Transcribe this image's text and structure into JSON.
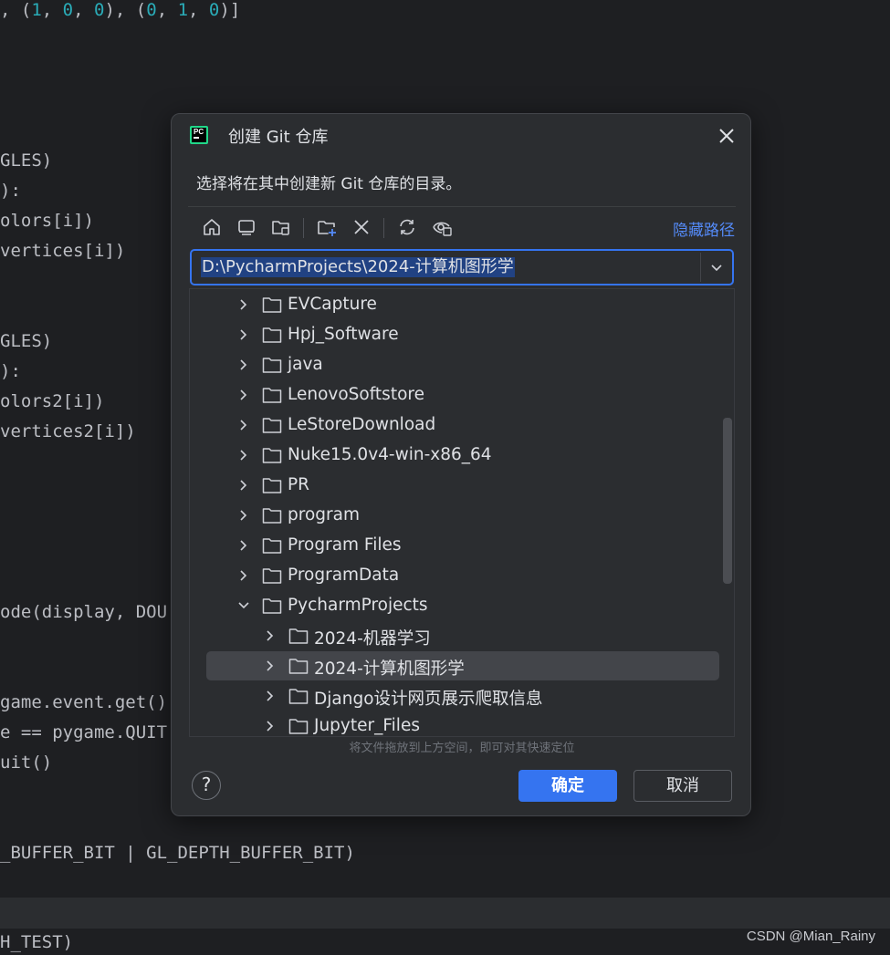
{
  "editor": {
    "lines": [
      {
        "segments": [
          {
            "t": ", (",
            "c": ""
          },
          {
            "t": "1",
            "c": "num"
          },
          {
            "t": ", ",
            "c": ""
          },
          {
            "t": "0",
            "c": "num"
          },
          {
            "t": ", ",
            "c": ""
          },
          {
            "t": "0",
            "c": "num"
          },
          {
            "t": "), (",
            "c": ""
          },
          {
            "t": "0",
            "c": "num"
          },
          {
            "t": ", ",
            "c": ""
          },
          {
            "t": "1",
            "c": "num"
          },
          {
            "t": ", ",
            "c": ""
          },
          {
            "t": "0",
            "c": "num"
          },
          {
            "t": ")]",
            "c": ""
          }
        ]
      },
      {
        "segments": [
          {
            "t": "GLES)",
            "c": ""
          }
        ]
      },
      {
        "segments": [
          {
            "t": "):",
            "c": ""
          }
        ]
      },
      {
        "segments": [
          {
            "t": "olors[i])",
            "c": ""
          }
        ]
      },
      {
        "segments": [
          {
            "t": "vertices[i])",
            "c": ""
          }
        ]
      },
      {
        "segments": [
          {
            "t": "GLES)",
            "c": ""
          }
        ]
      },
      {
        "segments": [
          {
            "t": "):",
            "c": ""
          }
        ]
      },
      {
        "segments": [
          {
            "t": "olors2[i])",
            "c": ""
          }
        ]
      },
      {
        "segments": [
          {
            "t": "vertices2[i])",
            "c": ""
          }
        ]
      },
      {
        "segments": [
          {
            "t": "ode(display, DOU",
            "c": ""
          }
        ]
      },
      {
        "segments": [
          {
            "t": "game.event.get():",
            "c": ""
          }
        ]
      },
      {
        "segments": [
          {
            "t": "e == pygame.QUIT",
            "c": ""
          }
        ]
      },
      {
        "segments": [
          {
            "t": "uit()",
            "c": ""
          }
        ]
      },
      {
        "segments": [
          {
            "t": "_BUFFER_BIT | GL_DEPTH_BUFFER_BIT)",
            "c": ""
          }
        ]
      },
      {
        "segments": [
          {
            "t": "H_TEST)",
            "c": ""
          }
        ]
      }
    ],
    "watermark": "CSDN @Mian_Rainy"
  },
  "dialog": {
    "title": "创建 Git 仓库",
    "subtitle": "选择将在其中创建新 Git 仓库的目录。",
    "hide_path_label": "隐藏路径",
    "path_value": "D:\\PycharmProjects\\2024-计算机图形学",
    "toolbar": [
      {
        "name": "home-icon"
      },
      {
        "name": "desktop-icon"
      },
      {
        "name": "project-folder-icon"
      },
      {
        "name": "new-folder-icon"
      },
      {
        "name": "delete-icon"
      },
      {
        "name": "refresh-icon"
      },
      {
        "name": "show-hidden-icon"
      }
    ],
    "tree": [
      {
        "label": "EVCapture",
        "depth": 0,
        "expanded": false,
        "selected": false
      },
      {
        "label": "Hpj_Software",
        "depth": 0,
        "expanded": false,
        "selected": false
      },
      {
        "label": "java",
        "depth": 0,
        "expanded": false,
        "selected": false
      },
      {
        "label": "LenovoSoftstore",
        "depth": 0,
        "expanded": false,
        "selected": false
      },
      {
        "label": "LeStoreDownload",
        "depth": 0,
        "expanded": false,
        "selected": false
      },
      {
        "label": "Nuke15.0v4-win-x86_64",
        "depth": 0,
        "expanded": false,
        "selected": false
      },
      {
        "label": "PR",
        "depth": 0,
        "expanded": false,
        "selected": false
      },
      {
        "label": "program",
        "depth": 0,
        "expanded": false,
        "selected": false
      },
      {
        "label": "Program Files",
        "depth": 0,
        "expanded": false,
        "selected": false
      },
      {
        "label": "ProgramData",
        "depth": 0,
        "expanded": false,
        "selected": false
      },
      {
        "label": "PycharmProjects",
        "depth": 0,
        "expanded": true,
        "selected": false
      },
      {
        "label": "2024-机器学习",
        "depth": 1,
        "expanded": false,
        "selected": false
      },
      {
        "label": "2024-计算机图形学",
        "depth": 1,
        "expanded": false,
        "selected": true
      },
      {
        "label": "Django设计网页展示爬取信息",
        "depth": 1,
        "expanded": false,
        "selected": false
      },
      {
        "label": "Jupyter_Files",
        "depth": 1,
        "expanded": false,
        "selected": false
      }
    ],
    "drop_hint": "将文件拖放到上方空间，即可对其快速定位",
    "help_label": "?",
    "ok_label": "确定",
    "cancel_label": "取消"
  },
  "colors": {
    "accent": "#3574f0",
    "link": "#548af7",
    "selection": "#214283",
    "code_number": "#2aacb8"
  }
}
